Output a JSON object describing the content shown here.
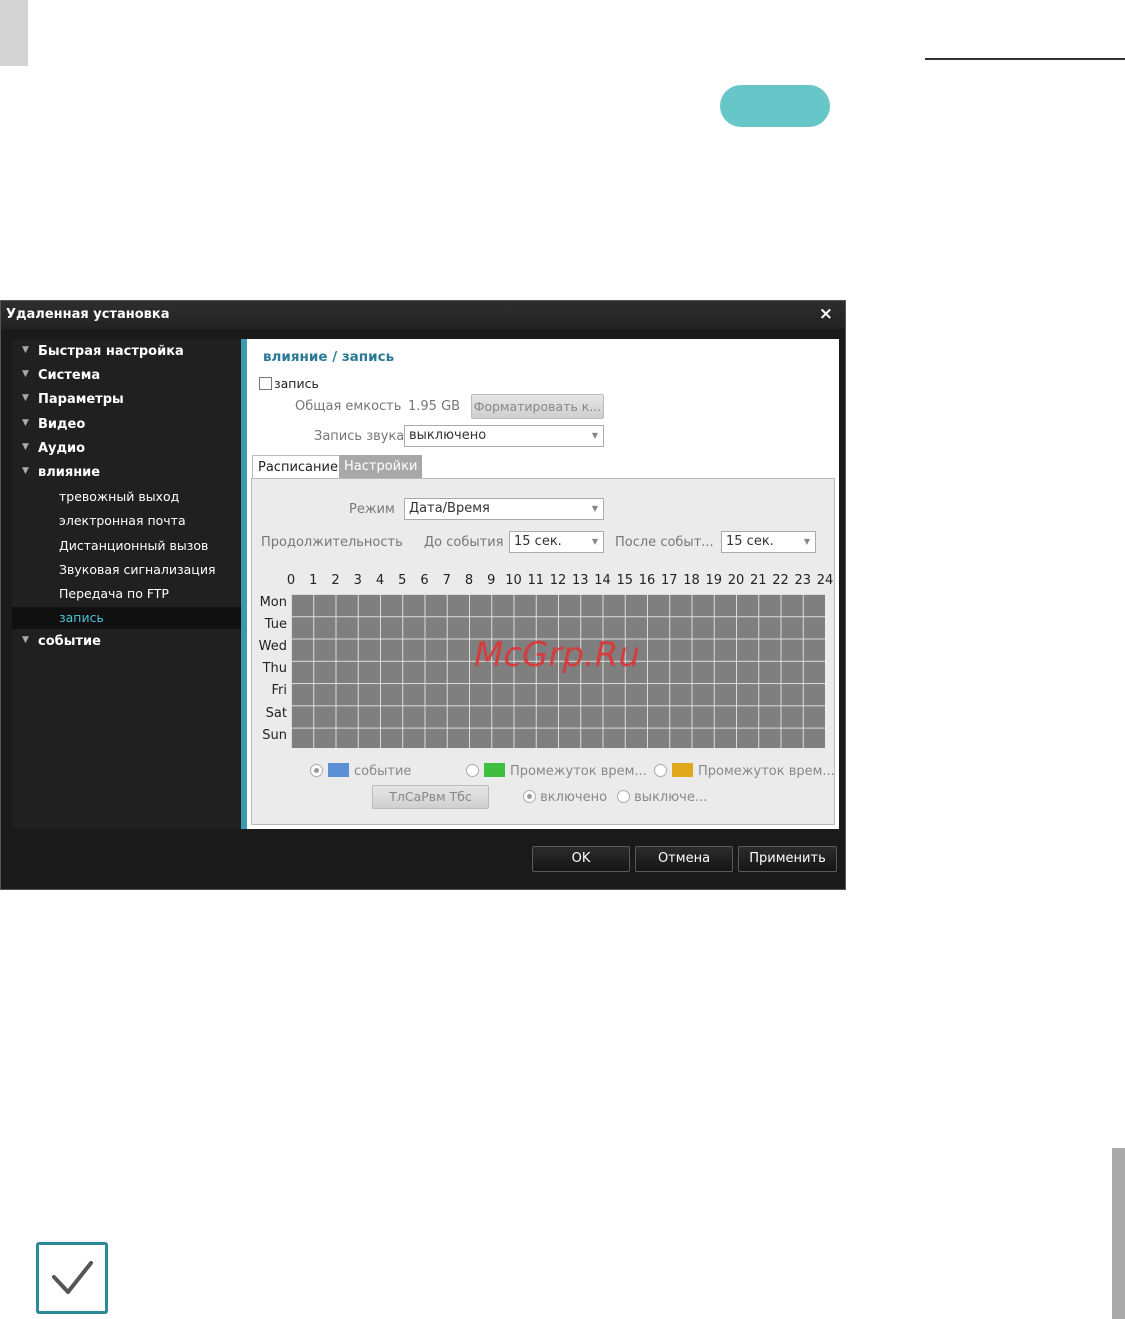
{
  "dialog": {
    "title": "Удаленная установка",
    "close": "×"
  },
  "sidebar": {
    "items": [
      {
        "label": "Быстрая настройка",
        "level": "parent"
      },
      {
        "label": "Система",
        "level": "parent"
      },
      {
        "label": "Параметры",
        "level": "parent"
      },
      {
        "label": "Видео",
        "level": "parent"
      },
      {
        "label": "Аудио",
        "level": "parent"
      },
      {
        "label": "влияние",
        "level": "parent"
      },
      {
        "label": "тревожный выход",
        "level": "child"
      },
      {
        "label": "электронная почта",
        "level": "child"
      },
      {
        "label": "Дистанционный вызов",
        "level": "child"
      },
      {
        "label": "Звуковая сигнализация",
        "level": "child"
      },
      {
        "label": "Передача по FTP",
        "level": "child"
      },
      {
        "label": "запись",
        "level": "child",
        "selected": true
      },
      {
        "label": "событие",
        "level": "parent"
      }
    ]
  },
  "content": {
    "title": "влияние / запись",
    "record_checkbox": "запись",
    "capacity_label": "Общая емкость",
    "capacity_value": "1.95 GB",
    "format_button": "Форматировать к...",
    "audio_label": "Запись звука",
    "audio_value": "выключено"
  },
  "tabs": [
    {
      "label": "Расписание",
      "active": true
    },
    {
      "label": "Настройки",
      "active": false
    }
  ],
  "schedule": {
    "mode_label": "Режим",
    "mode_value": "Дата/Время",
    "duration_label": "Продолжительность",
    "pre_label": "До события",
    "pre_value": "15 сек.",
    "post_label": "После событ...",
    "post_value": "15 сек.",
    "hours": [
      "0",
      "1",
      "2",
      "3",
      "4",
      "5",
      "6",
      "7",
      "8",
      "9",
      "10",
      "11",
      "12",
      "13",
      "14",
      "15",
      "16",
      "17",
      "18",
      "19",
      "20",
      "21",
      "22",
      "23",
      "24"
    ],
    "days": [
      "Mon",
      "Tue",
      "Wed",
      "Thu",
      "Fri",
      "Sat",
      "Sun"
    ],
    "legend": [
      {
        "label": "событие",
        "color": "#5b8fd6",
        "selected": true
      },
      {
        "label": "Промежуток врем...",
        "color": "#3fbf3f",
        "selected": false
      },
      {
        "label": "Промежуток врем...",
        "color": "#e0a81c",
        "selected": false
      }
    ],
    "clear_button": "ТлСаРвм Тбс",
    "on_label": "включено",
    "off_label": "выключе...",
    "on_selected": true
  },
  "footer": {
    "ok": "OK",
    "cancel": "Отмена",
    "apply": "Применить"
  },
  "watermark": "McGrp.Ru",
  "colors": {
    "accent": "#3a9bb0",
    "pill": "#67c6c8",
    "grid_cell": "#7f7f7f"
  }
}
